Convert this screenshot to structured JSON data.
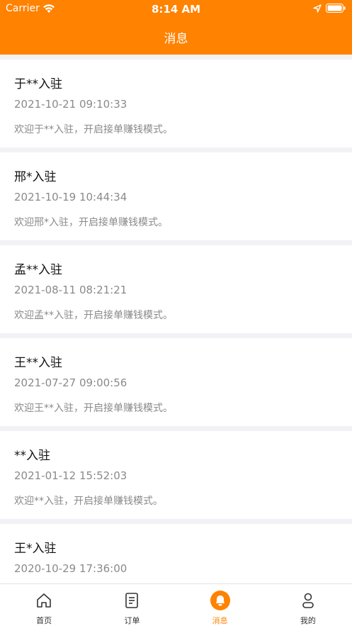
{
  "status_bar": {
    "carrier": "Carrier",
    "time": "8:14 AM"
  },
  "header": {
    "title": "消息"
  },
  "messages": [
    {
      "title": "于**入驻",
      "time": "2021-10-21 09:10:33",
      "body": "欢迎于**入驻，开启接单赚钱模式。"
    },
    {
      "title": "邢*入驻",
      "time": "2021-10-19 10:44:34",
      "body": "欢迎邢*入驻，开启接单赚钱模式。"
    },
    {
      "title": "孟**入驻",
      "time": "2021-08-11 08:21:21",
      "body": "欢迎孟**入驻，开启接单赚钱模式。"
    },
    {
      "title": "王**入驻",
      "time": "2021-07-27 09:00:56",
      "body": "欢迎王**入驻，开启接单赚钱模式。"
    },
    {
      "title": "**入驻",
      "time": "2021-01-12 15:52:03",
      "body": "欢迎**入驻，开启接单赚钱模式。"
    },
    {
      "title": "王*入驻",
      "time": "2020-10-29 17:36:00",
      "body": ""
    }
  ],
  "tabbar": {
    "items": [
      {
        "label": "首页",
        "icon": "home-icon"
      },
      {
        "label": "订单",
        "icon": "orders-icon"
      },
      {
        "label": "消息",
        "icon": "bell-icon",
        "active": true
      },
      {
        "label": "我的",
        "icon": "profile-icon"
      }
    ]
  },
  "colors": {
    "accent": "#ff8200",
    "background": "#f2f2f6",
    "muted_text": "#8a8a8a"
  }
}
